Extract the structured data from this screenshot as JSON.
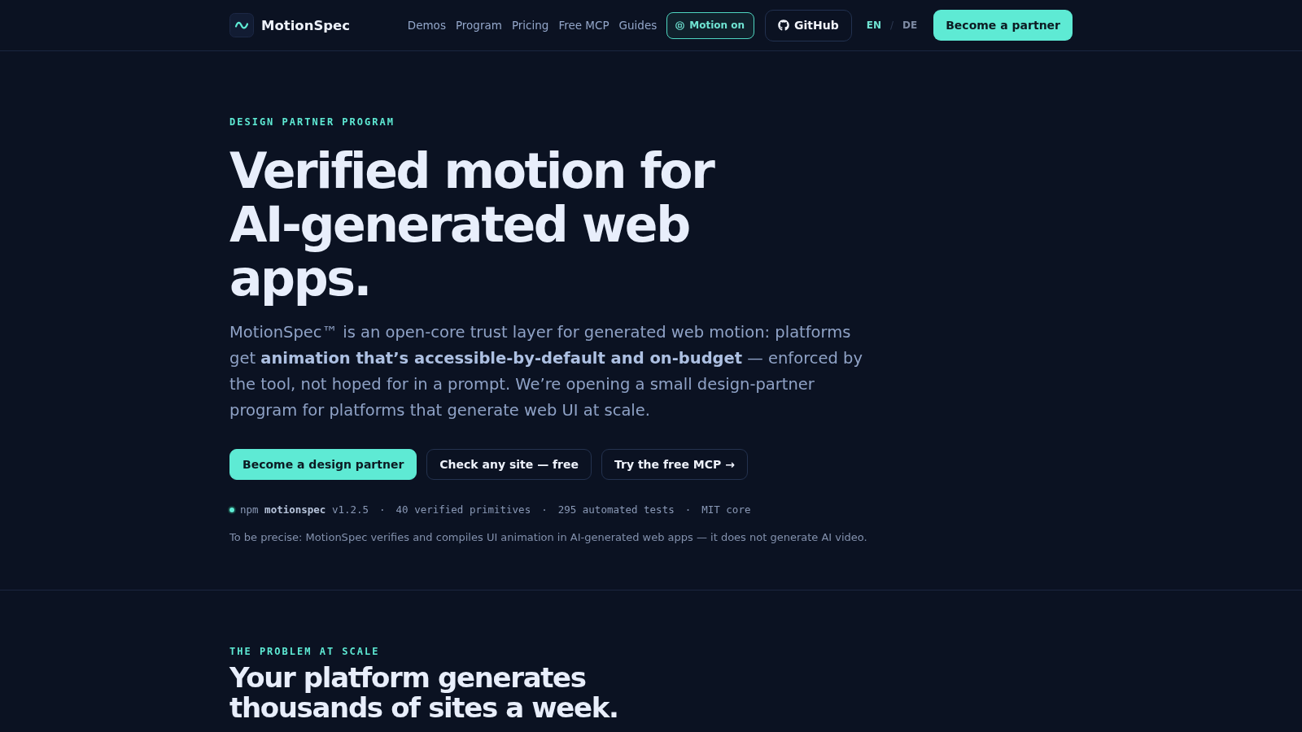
{
  "header": {
    "brand": "MotionSpec",
    "nav_links": [
      "Demos",
      "Program",
      "Pricing",
      "Free MCP",
      "Guides"
    ],
    "motion_toggle": {
      "label": "Motion on",
      "on": true
    },
    "github": {
      "label": "GitHub"
    },
    "languages": [
      {
        "label": "EN",
        "selected": true
      },
      {
        "label": "DE",
        "selected": false
      }
    ],
    "language_separator": "/",
    "cta": "Become a partner"
  },
  "hero": {
    "eyebrow": "DESIGN PARTNER PROGRAM",
    "title": "Verified motion for AI-generated web apps.",
    "lead": "MotionSpec™ is an open-core trust layer for generated web motion: platforms get **animation that’s accessible-by-default and on-budget** — enforced by the tool, not hoped for in a prompt. We’re opening a small design-partner program for platforms that generate web UI at scale.",
    "buttons": [
      {
        "label": "Become a design partner",
        "kind": "primary"
      },
      {
        "label": "Check any site — free",
        "kind": "secondary"
      },
      {
        "label": "Try the free MCP →",
        "kind": "secondary"
      }
    ],
    "meta": {
      "items": [
        "npm **motionspec** v1.2.5",
        "40 verified primitives",
        "295 automated tests",
        "MIT core"
      ],
      "separator": "·"
    },
    "disclaimer": "To be precise: MotionSpec verifies and compiles UI animation in AI-generated web apps — it does not generate AI video."
  },
  "problem": {
    "eyebrow": "THE PROBLEM AT SCALE",
    "title": "Your platform generates thousands of sites a week."
  }
}
